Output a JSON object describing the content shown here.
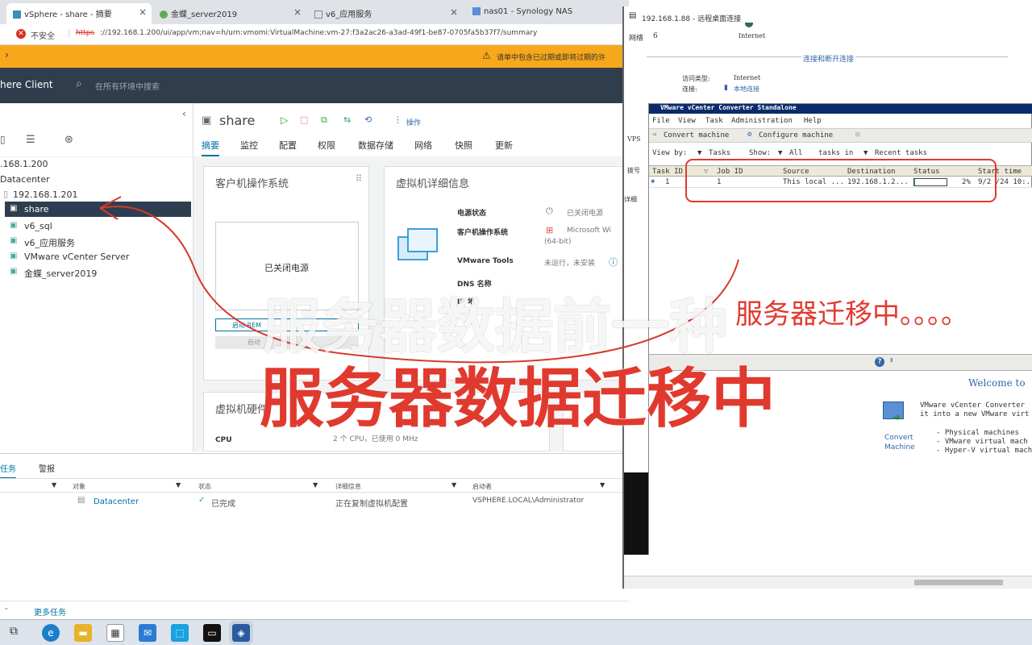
{
  "browser": {
    "tabs": [
      {
        "label": "vSphere - share - 摘要"
      },
      {
        "label": "金蝶_server2019"
      },
      {
        "label": "v6_应用服务"
      },
      {
        "label": "nas01 - Synology NAS"
      }
    ],
    "security_label": "不安全",
    "url_scheme": "https",
    "url": "://192.168.1.200/ui/app/vm;nav=h/urn:vmomi:VirtualMachine:vm-27:f3a2ac26-a3ad-49f1-be87-0705fa5b37f7/summary"
  },
  "warning": {
    "text": "请单中包含已过期或即将过期的许"
  },
  "vsphere": {
    "app_title": "here Client",
    "search_placeholder": "在所有环境中搜索",
    "tree": [
      {
        "label": ".168.1.200"
      },
      {
        "label": "Datacenter"
      },
      {
        "label": "192.168.1.201"
      },
      {
        "label": "share"
      },
      {
        "label": "v6_sql"
      },
      {
        "label": "v6_应用服务"
      },
      {
        "label": "VMware vCenter Server"
      },
      {
        "label": "金蝶_server2019"
      }
    ],
    "vm_title": "share",
    "actions_label": "操作",
    "tabs": [
      "摘要",
      "监控",
      "配置",
      "权限",
      "数据存储",
      "网络",
      "快照",
      "更新"
    ],
    "guest_os_card": {
      "title": "客户机操作系统",
      "console_text": "已关闭电源",
      "btn1": "启动 REM",
      "btn2": "启动"
    },
    "details_card": {
      "title": "虚拟机详细信息",
      "rows": [
        {
          "k": "电源状态",
          "v": "已关闭电源"
        },
        {
          "k": "客户机操作系统",
          "v": "Microsoft Wi",
          "sub": "(64-bit)"
        },
        {
          "k": "VMware Tools",
          "v": "未运行，未安装"
        },
        {
          "k": "DNS 名称",
          "v": ""
        },
        {
          "k": "IP 地",
          "v": ""
        }
      ]
    },
    "hw_card": {
      "title": "虚拟机硬件",
      "cpu_label": "CPU",
      "cpu_value": "2 个 CPU，已使用 0 MHz"
    }
  },
  "bottom": {
    "tabs": [
      "任务",
      "警报"
    ],
    "columns": [
      "对象",
      "状态",
      "详细信息",
      "启动者"
    ],
    "rows": [
      {
        "object": "Datacenter",
        "status": "已完成",
        "detail": "正在复制虚拟机配置",
        "initiator": "VSPHERE.LOCAL\\Administrator"
      }
    ],
    "more": "更多任务"
  },
  "rdp": {
    "title": "192.168.1.88 - 远程桌面连接",
    "net_label": "网络",
    "net_value": "6",
    "internet": "Internet",
    "disconnect": "连接和断开连接",
    "access_k": "访问类型:",
    "access_v": "Internet",
    "conn_k": "连接:",
    "conn_v": "本地连接",
    "side_labels": [
      "VPS",
      "拨号",
      "详细"
    ]
  },
  "converter": {
    "title": "VMware vCenter Converter Standalone",
    "menu": [
      "File",
      "View",
      "Task",
      "Administration",
      "Help"
    ],
    "toolbar": [
      "Convert machine",
      "Configure machine"
    ],
    "viewby": "View by:",
    "viewby_tasks": "Tasks",
    "show": "Show:",
    "show_all": "All",
    "tasks_in": "tasks in",
    "recent": "Recent tasks",
    "columns": [
      "Task ID",
      "Job ID",
      "Source",
      "Destination",
      "Status",
      "Start time"
    ],
    "row": {
      "task": "1",
      "job": "1",
      "source": "This local ...",
      "dest": "192.168.1.2...",
      "status": "2%",
      "start": "9/2 /24 10:..."
    },
    "progress": 0.02,
    "welcome": "Welcome to",
    "desc1": "VMware vCenter Converter",
    "desc2": "it into a new VMware virt",
    "convert_label1": "Convert",
    "convert_label2": "Machine",
    "bullets": [
      "- Physical machines",
      "- VMware virtual mach",
      "- Hyper-V virtual mach"
    ]
  },
  "overlay": {
    "ghost": "服务器数据前一种",
    "main": "服务器数据迁移中",
    "annot": "服务器迁移中。。。。"
  },
  "colors": {
    "accent": "#e03a2f",
    "warn": "#f7a81b",
    "header": "#2f3d4c",
    "selected": "#2d3e50"
  }
}
